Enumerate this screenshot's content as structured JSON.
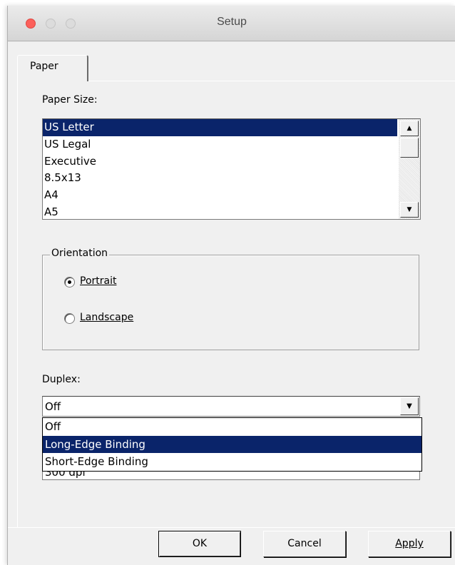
{
  "window": {
    "title": "Setup"
  },
  "tabs": [
    {
      "label": "Paper",
      "active": true
    }
  ],
  "paper_size": {
    "label": "Paper Size:",
    "items": [
      "US Letter",
      "US Legal",
      "Executive",
      "8.5x13",
      "A4",
      "A5"
    ],
    "selected": "US Letter",
    "scroll_up_icon": "arrow-up-icon",
    "scroll_down_icon": "arrow-down-icon"
  },
  "orientation": {
    "label": "Orientation",
    "options": [
      {
        "label": "Portrait",
        "selected": true
      },
      {
        "label": "Landscape",
        "selected": false
      }
    ]
  },
  "duplex": {
    "label": "Duplex:",
    "value": "Off",
    "options": [
      "Off",
      "Long-Edge Binding",
      "Short-Edge Binding"
    ],
    "highlighted": "Long-Edge Binding"
  },
  "resolution": {
    "value": "300 dpi"
  },
  "buttons": {
    "ok": "OK",
    "cancel": "Cancel",
    "apply": "Apply"
  },
  "colors": {
    "selection": "#0a246a",
    "close_button": "#fc605b"
  }
}
